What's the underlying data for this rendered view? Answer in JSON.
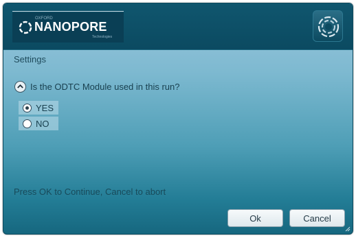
{
  "header": {
    "logo": {
      "brand_text": "NANOPORE",
      "prefix_text": "OXFORD",
      "suffix_text": "Technologies",
      "icon": "nanopore-swirl-icon"
    },
    "app_icon": "nanopore-app-icon"
  },
  "main": {
    "section_title": "Settings",
    "question": {
      "icon": "collapse-up-icon",
      "text": "Is the ODTC Module used in this run?"
    },
    "options": [
      {
        "label": "YES",
        "selected": true
      },
      {
        "label": "NO",
        "selected": false
      }
    ],
    "status_text": "Press OK to Continue, Cancel to abort"
  },
  "footer": {
    "ok_label": "Ok",
    "cancel_label": "Cancel"
  },
  "colors": {
    "header_bg": "#0b4a61",
    "gradient_top": "#9dc7de",
    "gradient_bottom": "#16677f"
  }
}
